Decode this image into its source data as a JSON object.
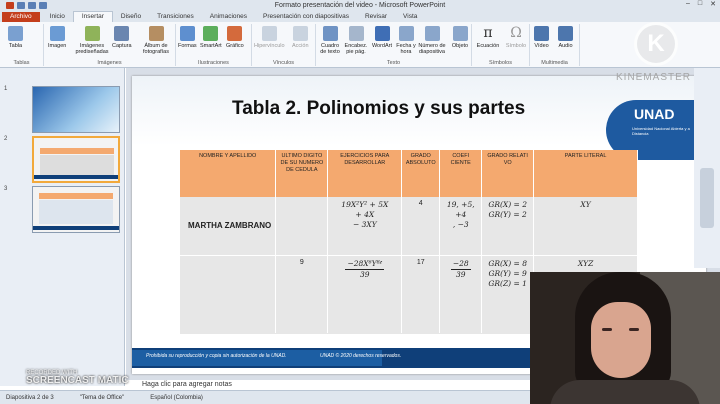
{
  "window": {
    "title": "Formato presentación del video  -  Microsoft PowerPoint"
  },
  "tabs": [
    "Archivo",
    "Inicio",
    "Insertar",
    "Diseño",
    "Transiciones",
    "Animaciones",
    "Presentación con diapositivas",
    "Revisar",
    "Vista"
  ],
  "ribbon": {
    "groups": [
      "Tablas",
      "Imágenes",
      "Ilustraciones",
      "Vínculos",
      "Texto",
      "Símbolos",
      "Multimedia"
    ],
    "buttons": [
      "Tabla",
      "Imagen",
      "Imágenes prediseñadas",
      "Captura",
      "Álbum de fotografías",
      "Formas",
      "SmartArt",
      "Gráfico",
      "Hipervínculo",
      "Acción",
      "Cuadro de texto",
      "Encabez. pie pág.",
      "WordArt",
      "Fecha y hora",
      "Número de diapositiva",
      "Objeto",
      "Ecuación",
      "Símbolo",
      "Vídeo",
      "Audio"
    ]
  },
  "slides": {
    "numbers": [
      "1",
      "2",
      "3"
    ]
  },
  "slide": {
    "title": "Tabla 2. Polinomios y sus partes",
    "logo": {
      "text": "UNAD",
      "sub": "Universidad Nacional Abierta y a Distancia"
    },
    "headers": [
      "NOMBRE Y APELLIDO",
      "ULTIMO DIGITO DE SU NUMERO DE CEDULA",
      "EJERCICIOS PARA DESARROLLAR",
      "GRADO ABSOLUTO",
      "COEFI CIENTE",
      "GRADO RELATI VO",
      "PARTE LITERAL"
    ],
    "row1": {
      "name": "MARTHA ZAMBRANO",
      "digit": "",
      "expr1": "19X²Y² + 5X",
      "expr2": "+ 4X",
      "expr3": "− 3XY",
      "grado": "4",
      "coef1": "19, +5, +4",
      "coef2": ", −3",
      "rel1": "GR(X) = 2",
      "rel2": "GR(Y) = 2",
      "lit": "XY"
    },
    "row2": {
      "digit": "9",
      "num": "−28X⁶Y⁸ᶻ",
      "den": "39",
      "grado": "17",
      "cnum": "−28",
      "cden": "39",
      "rel1": "GR(X) = 8",
      "rel2": "GR(Y) = 9",
      "rel3": "GR(Z) = 1",
      "lit": "XYZ"
    },
    "footer": {
      "left": "Prohibida su reproducción y copia sin autorización de la UNAD.",
      "right": "UNAD © 2020 derechos reservados."
    }
  },
  "notes": {
    "placeholder": "Haga clic para agregar notas"
  },
  "statusbar": {
    "slide": "Diapositiva 2 de 3",
    "theme": "\"Tema de Office\"",
    "lang": "Español (Colombia)"
  },
  "overlay": {
    "kinemaster": "KINEMASTER",
    "k": "K",
    "recorded": "RECORDED WITH",
    "screencast": "SCREENCAST",
    "omatic": "MATIC"
  },
  "colors": {
    "file_tab": "#c43e1c",
    "header_orange": "#f4a96f",
    "unad_blue": "#1e5aa0"
  }
}
